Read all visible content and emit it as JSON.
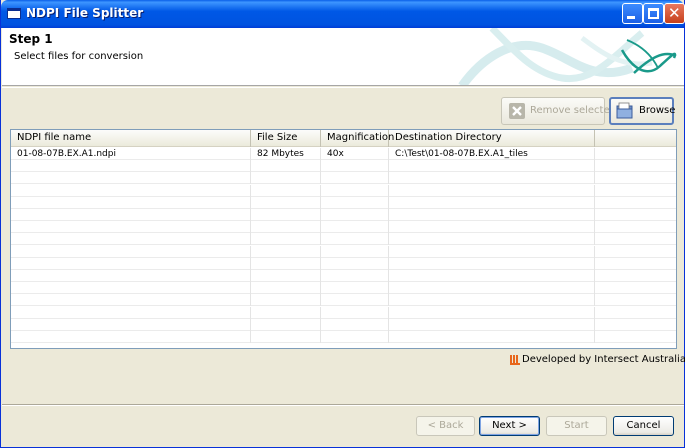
{
  "window": {
    "title": "NDPI File Splitter",
    "accent": "#0054e3",
    "close_color": "#d7502d"
  },
  "header": {
    "step_title": "Step 1",
    "step_subtitle": "Select files for conversion"
  },
  "toolbar": {
    "remove_label": "Remove selected",
    "browse_label": "Browse"
  },
  "table": {
    "columns": [
      "NDPI file name",
      "File Size",
      "Magnification",
      "Destination Directory",
      ""
    ],
    "rows": [
      [
        "01-08-07B.EX.A1.ndpi",
        "82 Mbytes",
        "40x",
        "C:\\Test\\01-08-07B.EX.A1_tiles",
        ""
      ]
    ]
  },
  "footer": {
    "credit": "Developed by Intersect Australia Ltd"
  },
  "wizard": {
    "back_label": "< Back",
    "next_label": "Next >",
    "start_label": "Start",
    "cancel_label": "Cancel"
  }
}
